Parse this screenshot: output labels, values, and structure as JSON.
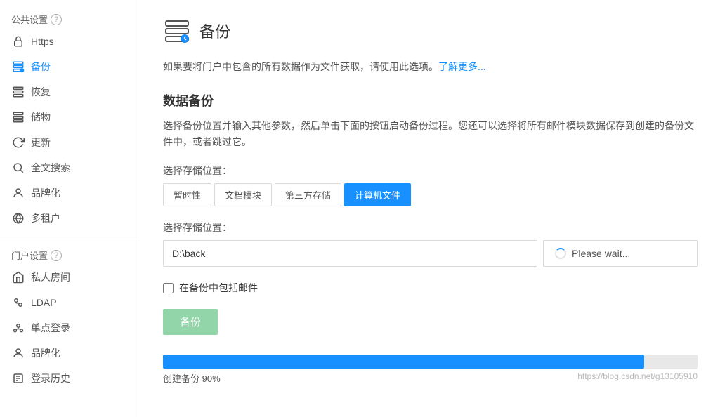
{
  "sidebar": {
    "public_section": {
      "label": "公共设置",
      "help": "?"
    },
    "public_items": [
      {
        "id": "https",
        "label": "Https",
        "icon": "lock"
      },
      {
        "id": "backup",
        "label": "备份",
        "icon": "backup",
        "active": true
      },
      {
        "id": "restore",
        "label": "恢复",
        "icon": "restore"
      },
      {
        "id": "storage",
        "label": "储物",
        "icon": "storage"
      },
      {
        "id": "update",
        "label": "更新",
        "icon": "update"
      },
      {
        "id": "fulltext",
        "label": "全文搜索",
        "icon": "search"
      },
      {
        "id": "branding",
        "label": "品牌化",
        "icon": "brand"
      },
      {
        "id": "multitenant",
        "label": "多租户",
        "icon": "globe"
      }
    ],
    "portal_section": {
      "label": "门户设置",
      "help": "?"
    },
    "portal_items": [
      {
        "id": "privateroom",
        "label": "私人房间",
        "icon": "room"
      },
      {
        "id": "ldap",
        "label": "LDAP",
        "icon": "ldap"
      },
      {
        "id": "sso",
        "label": "单点登录",
        "icon": "sso"
      },
      {
        "id": "branding2",
        "label": "品牌化",
        "icon": "brand"
      },
      {
        "id": "loginhistory",
        "label": "登录历史",
        "icon": "history"
      }
    ]
  },
  "page": {
    "title": "备份",
    "description": "如果要将门户中包含的所有数据作为文件获取，请使用此选项。了解更多...",
    "learn_more": "了解更多...",
    "section_title": "数据备份",
    "section_desc": "选择备份位置并输入其他参数，然后单击下面的按钮启动备份过程。您还可以选择将所有邮件模块数据保存到创建的备份文件中，或者跳过它。",
    "storage_label": "选择存储位置：",
    "storage_buttons": [
      {
        "id": "temp",
        "label": "暂时性",
        "active": false
      },
      {
        "id": "docs",
        "label": "文档模块",
        "active": false
      },
      {
        "id": "third",
        "label": "第三方存储",
        "active": false
      },
      {
        "id": "local",
        "label": "计算机文件",
        "active": true
      }
    ],
    "path_label": "选择存储位置：",
    "path_value": "D:\\back",
    "please_wait_label": "Please wait...",
    "include_email_label": "在备份中包括邮件",
    "backup_button": "备份",
    "progress": {
      "value": 90,
      "label": "创建备份 90%"
    },
    "watermark": "https://blog.csdn.net/g13105910"
  }
}
